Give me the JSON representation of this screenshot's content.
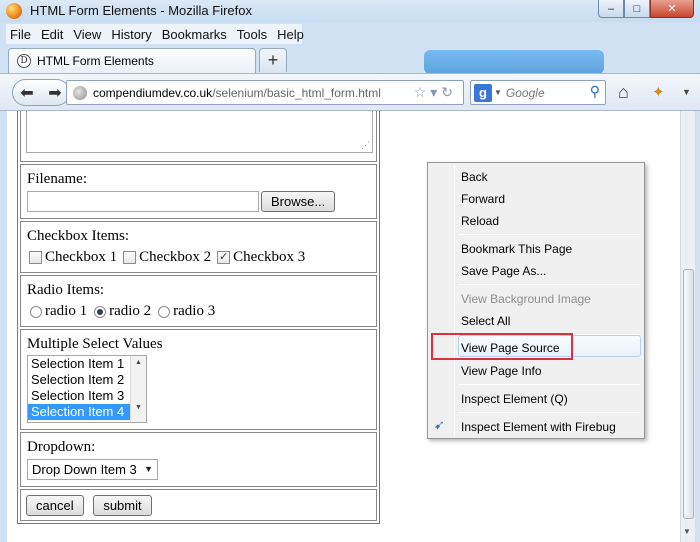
{
  "window": {
    "title": "HTML Form Elements - Mozilla Firefox",
    "controls": {
      "minimize": "–",
      "maximize": "□",
      "close": "✕"
    }
  },
  "menubar": {
    "items": [
      {
        "label": "File"
      },
      {
        "label": "Edit"
      },
      {
        "label": "View"
      },
      {
        "label": "History"
      },
      {
        "label": "Bookmarks"
      },
      {
        "label": "Tools"
      },
      {
        "label": "Help"
      }
    ]
  },
  "tabs": {
    "active_label": "HTML Form Elements",
    "new_tab": "+"
  },
  "navbar": {
    "back": "⬅",
    "forward": "➡",
    "url_host": "compendiumdev.co.uk",
    "url_path": "/selenium/basic_html_form.html",
    "url_icons": "☆▾↻",
    "search_placeholder": "Google",
    "search_engine_letter": "g",
    "search_engine_dropdown": "▼",
    "search_go": "⚲",
    "home": "⌂",
    "firebug": "✦",
    "menu_dropdown": "▼"
  },
  "form": {
    "textarea_grip": "⋰",
    "filename_label": "Filename:",
    "browse_button": "Browse...",
    "checkbox_label": "Checkbox Items:",
    "checkboxes": [
      {
        "label": "Checkbox 1",
        "mark": ""
      },
      {
        "label": "Checkbox 2",
        "mark": ""
      },
      {
        "label": "Checkbox 3",
        "mark": "✓"
      }
    ],
    "radio_label": "Radio Items:",
    "radios": [
      {
        "label": "radio 1"
      },
      {
        "label": "radio 2"
      },
      {
        "label": "radio 3"
      }
    ],
    "multiselect_label": "Multiple Select Values",
    "multiselect_options": [
      {
        "label": "Selection Item 1"
      },
      {
        "label": "Selection Item 2"
      },
      {
        "label": "Selection Item 3"
      },
      {
        "label": "Selection Item 4"
      }
    ],
    "multiselect_scroll_up": "▲",
    "multiselect_scroll_down": "▼",
    "dropdown_label": "Dropdown:",
    "dropdown_value": "Drop Down Item 3",
    "dropdown_arrow": "▼",
    "cancel_button": "cancel",
    "submit_button": "submit"
  },
  "scrollbar": {
    "down_arrow": "▼"
  },
  "context_menu": {
    "items": [
      {
        "label": "Back"
      },
      {
        "label": "Forward"
      },
      {
        "label": "Reload"
      },
      {
        "label": "Bookmark This Page"
      },
      {
        "label": "Save Page As..."
      },
      {
        "label": "View Background Image"
      },
      {
        "label": "Select All"
      },
      {
        "label": "View Page Source"
      },
      {
        "label": "View Page Info"
      },
      {
        "label": "Inspect Element (Q)"
      },
      {
        "label": "Inspect Element with Firebug"
      }
    ],
    "firebug_icon": "➹"
  }
}
